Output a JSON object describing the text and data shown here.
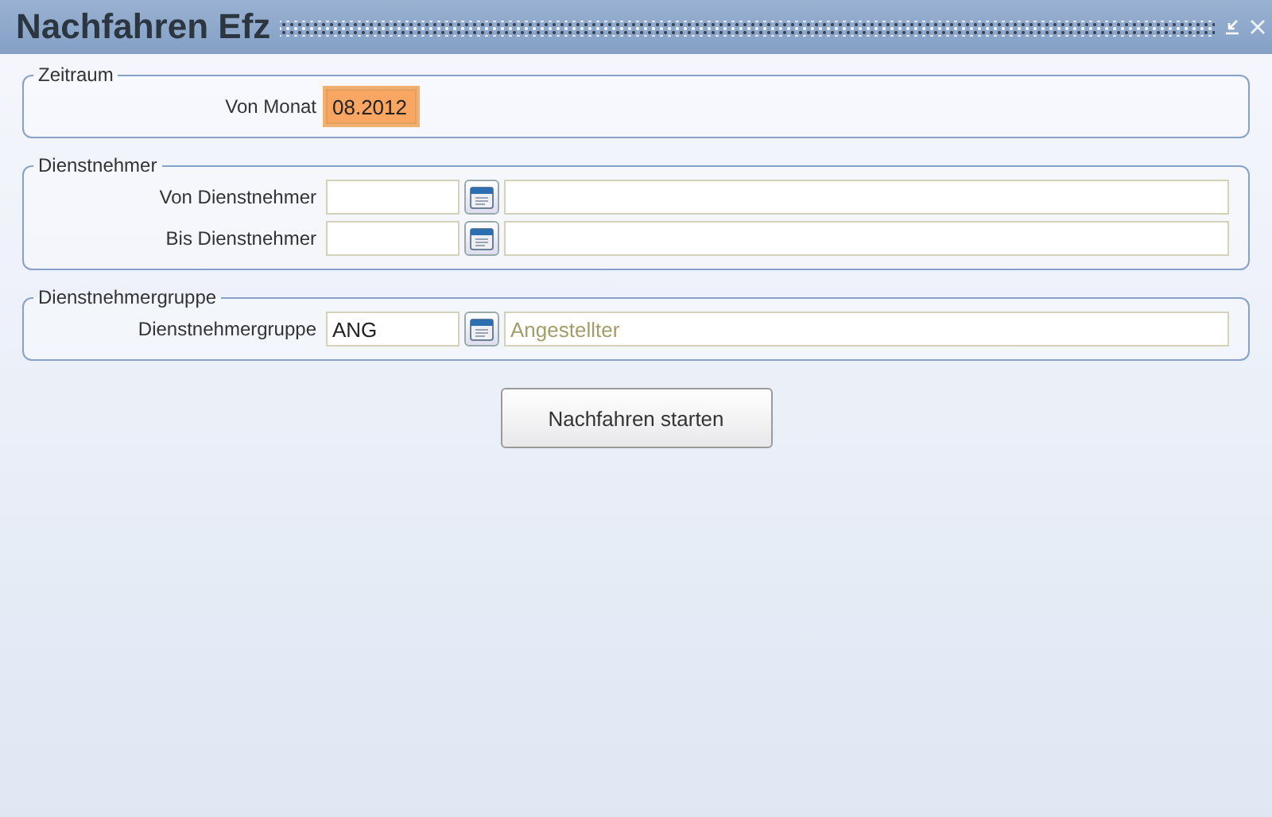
{
  "window": {
    "title": "Nachfahren Efz"
  },
  "groups": [
    {
      "legend": "Zeitraum",
      "rows": [
        {
          "kind": "single",
          "label": "Von Monat",
          "value": "08.2012",
          "focused": true
        }
      ]
    },
    {
      "legend": "Dienstnehmer",
      "rows": [
        {
          "kind": "lookup",
          "label": "Von Dienstnehmer",
          "value": "",
          "description": ""
        },
        {
          "kind": "lookup",
          "label": "Bis Dienstnehmer",
          "value": "",
          "description": ""
        }
      ]
    },
    {
      "legend": "Dienstnehmergruppe",
      "rows": [
        {
          "kind": "lookup",
          "label": "Dienstnehmergruppe",
          "value": "ANG",
          "description": "Angestellter"
        }
      ]
    }
  ],
  "action_button": {
    "label": "Nachfahren starten"
  }
}
